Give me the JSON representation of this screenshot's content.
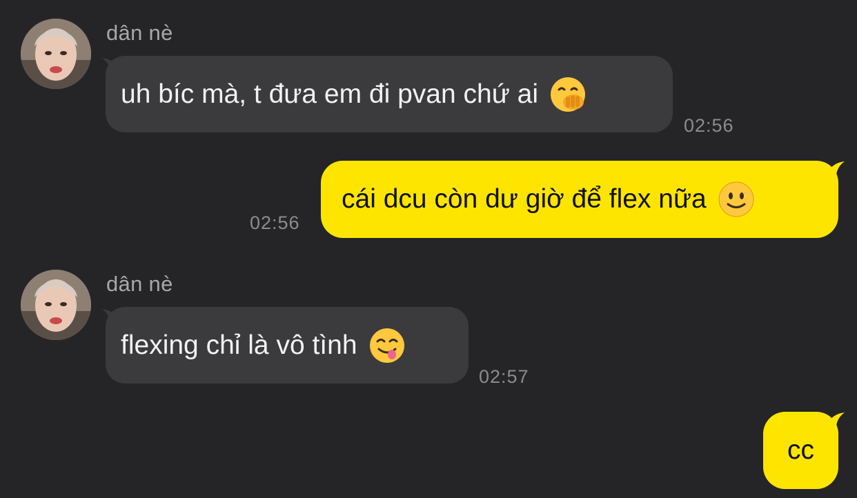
{
  "messages": [
    {
      "side": "in",
      "sender": "dân nè",
      "text": "uh bíc mà, t đưa em đi pvan chứ ai",
      "emoji": "face-with-hand-over-mouth",
      "time": "02:56"
    },
    {
      "side": "out",
      "text": "cái dcu còn dư giờ để flex nữa",
      "emoji": "slightly-smiling-face",
      "time": "02:56"
    },
    {
      "side": "in",
      "sender": "dân nè",
      "text": "flexing chỉ là vô tình",
      "emoji": "face-savoring-food",
      "time": "02:57"
    },
    {
      "side": "out",
      "text": "cc"
    }
  ],
  "colors": {
    "background": "#252527",
    "incoming_bubble": "#3b3b3d",
    "outgoing_bubble": "#fee500",
    "timestamp": "#8c8c8e",
    "sender_name": "#a8a8aa"
  }
}
